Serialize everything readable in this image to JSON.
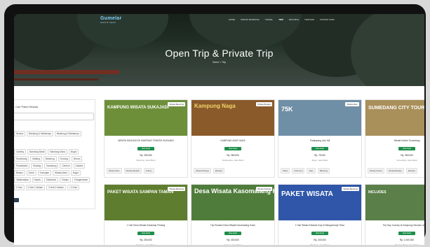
{
  "brand": {
    "logo": "Gumelar",
    "tagline": "tours & travel"
  },
  "nav": [
    "Home",
    "Wisata Bandung",
    "Travel",
    "Trip",
    "Booking",
    "Tentang",
    "Kontak Kami"
  ],
  "nav_active": 3,
  "hero": {
    "title": "Open Trip & Private Trip",
    "breadcrumb": "Home > Trip"
  },
  "sidebar": {
    "heading": "Cari Paket Wisata",
    "search_placeholder": "",
    "chips_row1": [
      "Semua",
      "Bandung & Sekitarnya",
      "Bandung & Sekitarnya"
    ],
    "chips_row2": [
      "Ciwidey",
      "Bandung Barat",
      "Bandung Utara",
      "Bogor",
      "Sumedang",
      "Malang",
      "Bandung",
      "Gunung",
      "Bromo",
      "Purwakarta",
      "Subang",
      "Karawang",
      "Cirebon",
      "Jakarta",
      "Bekasi",
      "Garut",
      "Kuningan",
      "Wisata Alam",
      "Bogor",
      "Tasikmalaya",
      "Depok",
      "Sukabumi",
      "Cianjur",
      "Pangandaran"
    ],
    "chips_row3": [
      "1 Hari",
      "2 Hari 1 Malam",
      "3 Hari 2 Malam",
      "> 3 Hari"
    ]
  },
  "cards": [
    {
      "image_text": "KAMPUNG WISATA SUKAJADI",
      "image_bg": "#6d8f3a",
      "image_text_color": "#ffffff",
      "sticker": "Wisata Bandung",
      "title": "WISATA EDUKASI KE KAMPUNG TEMATIK SUKAJADI",
      "badge": "lihat detail",
      "price": "Rp. 250.000",
      "location": "Bandung, Jawa Barat",
      "tags": [
        "Wisata Alam",
        "Wisata Edukasi",
        "Kuliner"
      ]
    },
    {
      "image_text": "Kampung Naga",
      "image_bg": "#8a5a2a",
      "image_text_color": "#f2d36b",
      "sticker": "Wisata Budaya",
      "title": "KAMPUNG ADAT NAGA",
      "badge": "lihat detail",
      "price": "Rp. 380.000",
      "location": "Tasikmalaya, Jawa Barat",
      "tags": [
        "Wisata Budaya",
        "Edukasi"
      ]
    },
    {
      "image_text": "75K",
      "image_bg": "#6f8fa6",
      "image_text_color": "#ffffff",
      "sticker": "Wisata Alam",
      "title": "Paralayang Lido Hill",
      "badge": "lihat detail",
      "price": "Rp. 75.000",
      "location": "Bogor, Jawa Barat",
      "tags": [
        "Paket",
        "Outbound",
        "Alam",
        "Bandung"
      ]
    },
    {
      "image_text": "SUMEDANG CITY TOUR",
      "image_bg": "#a98f5a",
      "image_text_color": "#ffffff",
      "sticker": "Wisata Budaya",
      "title": "Wisata Kuliner Sumedang",
      "badge": "lihat detail",
      "price": "Rp. 350.000",
      "location": "Sumedang, Jawa Barat",
      "tags": [
        "Wisata Kuliner",
        "Wisata Budaya",
        "Edukasi"
      ]
    },
    {
      "image_text": "PAKET WISATA SAMPAN TAMAN",
      "image_bg": "#5e7d2e",
      "image_text_color": "#ffffff",
      "sticker": "Wisata Bandung",
      "title": "1 Hari Desa Wisata Sukamaju Pedang",
      "badge": "lihat detail",
      "price": "Rp. 250.000",
      "location": "Bandung, Jawa Barat",
      "tags": []
    },
    {
      "image_text": "Desa Wisata Kasomalang Kulon",
      "image_bg": "#4f7c3a",
      "image_text_color": "#ffffff",
      "sticker": "Wisata Subang",
      "title": "Trip Edukasi Desa Wisata Kasomalang Kulon",
      "badge": "lihat detail",
      "price": "Rp. 300.000",
      "location": "Subang, Jawa Barat",
      "tags": []
    },
    {
      "image_text": "PAKET WISATA",
      "image_bg": "#2f56a8",
      "image_text_color": "#ffffff",
      "sticker": "Wisata Bandung",
      "title": "1 Hari Wisata Edukasi Kopi di Wangunharja Timur",
      "badge": "lihat detail",
      "price": "Rp. 200.000",
      "location": "Bandung, Jawa Barat",
      "tags": []
    },
    {
      "image_text": "INCLUDES",
      "image_bg": "#5a7f48",
      "image_text_color": "#ffffff",
      "sticker": "Wisata Alam",
      "title": "Trip Day Journey di Kampung Cibodas Lembang",
      "badge": "lihat detail",
      "price": "Rp. 1.000.000",
      "location": "Bandung Barat, Jawa Barat",
      "tags": []
    }
  ]
}
